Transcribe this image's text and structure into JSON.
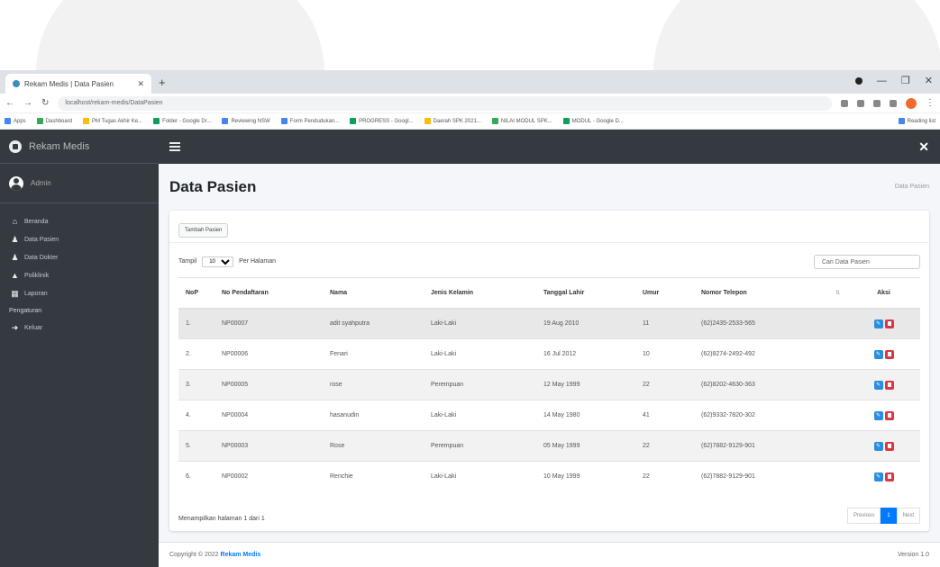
{
  "browser": {
    "tab_title": "Rekam Medis | Data Pasien",
    "url": "localhost/rekam-medis/DataPasien",
    "bookmarks": [
      "Apps",
      "Dashboard",
      "PM Tugas Akhir Ke...",
      "Folder - Google Dr...",
      "Reviewing NSW",
      "Form Pendudukan...",
      "PROGRESS - Googl...",
      "Daerah SPK 2021...",
      "NILAI MODUL SPK...",
      "MODUL - Google D...",
      "Reading list"
    ]
  },
  "sidebar": {
    "brand": "Rekam Medis",
    "user": "Admin",
    "items": [
      {
        "label": "Beranda",
        "icon": "home-icon"
      },
      {
        "label": "Data Pasien",
        "icon": "user-icon"
      },
      {
        "label": "Data Dokter",
        "icon": "user-icon"
      },
      {
        "label": "Poliklinik",
        "icon": "building-icon"
      },
      {
        "label": "Laporan",
        "icon": "report-icon"
      }
    ],
    "header": "Pengaturan",
    "logout": {
      "label": "Keluar",
      "icon": "sign-out-icon"
    }
  },
  "page": {
    "title": "Data Pasien",
    "breadcrumb": "Data Pasien",
    "add_button": "Tambah Pasien",
    "show_label": "Tampil",
    "show_value": "10",
    "per_page_label": "Per Halaman",
    "search_placeholder": "Cari Data Pasien",
    "columns": [
      "NoP",
      "No Pendaftaran",
      "Nama",
      "Jenis Kelamin",
      "Tanggal Lahir",
      "Umur",
      "Nomor Telepon",
      "Aksi"
    ],
    "rows": [
      {
        "no": "1.",
        "reg": "NP00007",
        "name": "adit syahputra",
        "gender": "Laki-Laki",
        "dob": "19 Aug 2010",
        "age": "11",
        "phone": "(62)2435-2533-565"
      },
      {
        "no": "2.",
        "reg": "NP00006",
        "name": "Fenari",
        "gender": "Laki-Laki",
        "dob": "16 Jul 2012",
        "age": "10",
        "phone": "(62)8274-2492-492"
      },
      {
        "no": "3.",
        "reg": "NP00005",
        "name": "rose",
        "gender": "Perempuan",
        "dob": "12 May 1999",
        "age": "22",
        "phone": "(62)8202-4630-363"
      },
      {
        "no": "4.",
        "reg": "NP00004",
        "name": "hasanudin",
        "gender": "Laki-Laki",
        "dob": "14 May 1980",
        "age": "41",
        "phone": "(62)9332-7820-302"
      },
      {
        "no": "5.",
        "reg": "NP00003",
        "name": "Rose",
        "gender": "Perempuan",
        "dob": "05 May 1999",
        "age": "22",
        "phone": "(62)7882-9129-901"
      },
      {
        "no": "6.",
        "reg": "NP00002",
        "name": "Renchie",
        "gender": "Laki-Laki",
        "dob": "10 May 1999",
        "age": "22",
        "phone": "(62)7882-9129-901"
      }
    ],
    "info": "Menampilkan halaman 1 dari 1",
    "pager": {
      "prev": "Previous",
      "current": "1",
      "next": "Next"
    }
  },
  "footer": {
    "copyright": "Copyright © 2022",
    "brand": "Rekam Medis",
    "version": "Version 1.0"
  }
}
